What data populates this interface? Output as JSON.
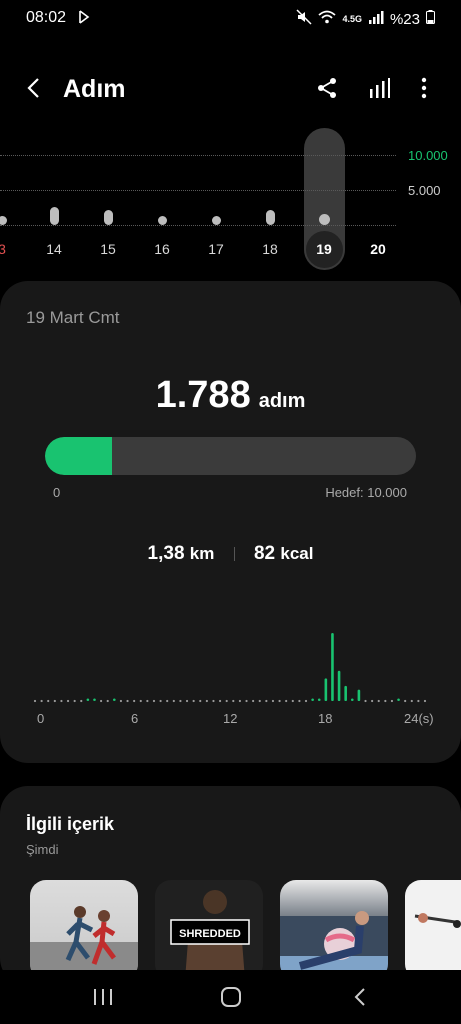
{
  "status": {
    "time": "08:02",
    "network": "4.5G",
    "battery": "%23",
    "icons": [
      "nfc-icon",
      "mute-icon",
      "wifi-icon",
      "signal-icon",
      "battery-icon"
    ]
  },
  "header": {
    "title": "Adım"
  },
  "week": {
    "gridlines": [
      "10.000",
      "5.000"
    ],
    "days": [
      {
        "label": "3",
        "value": 800
      },
      {
        "label": "14",
        "value": 2600
      },
      {
        "label": "15",
        "value": 2100
      },
      {
        "label": "16",
        "value": 1300
      },
      {
        "label": "17",
        "value": 700
      },
      {
        "label": "18",
        "value": 2100
      },
      {
        "label": "19",
        "value": 1788
      },
      {
        "label": "20",
        "value": 0
      }
    ],
    "selected": "19"
  },
  "summary": {
    "date": "19 Mart Cmt",
    "steps": "1.788",
    "steps_unit": "adım",
    "progress": 0.18,
    "min_label": "0",
    "goal_label": "Hedef: 10.000",
    "distance": "1,38",
    "distance_unit": "km",
    "calories": "82",
    "calories_unit": "kcal"
  },
  "chart_data": {
    "type": "bar",
    "x": [
      0,
      6,
      12,
      18,
      24
    ],
    "tick_labels": [
      "0",
      "6",
      "12",
      "18",
      "24(s)"
    ],
    "hourly_values": [
      0,
      0,
      0,
      0,
      0,
      0,
      0,
      0,
      5,
      10,
      0,
      0,
      10,
      0,
      0,
      0,
      0,
      0,
      0,
      0,
      0,
      0,
      0,
      0,
      0,
      0,
      0,
      0,
      0,
      0,
      0,
      0,
      0,
      0,
      0,
      0,
      0,
      0,
      0,
      0,
      0,
      0,
      10,
      10,
      120,
      360,
      160,
      80,
      5,
      60,
      0,
      0,
      0,
      0,
      0,
      10,
      0,
      0,
      0,
      0
    ],
    "color": "#19c370"
  },
  "related": {
    "title": "İlgili içerik",
    "subtitle": "Şimdi",
    "items": [
      {
        "kind": "running"
      },
      {
        "kind": "shredded",
        "text": "SHREDDED"
      },
      {
        "kind": "ball"
      },
      {
        "kind": "band"
      }
    ]
  },
  "nav": {
    "buttons": [
      "recent-apps",
      "home",
      "back"
    ]
  }
}
